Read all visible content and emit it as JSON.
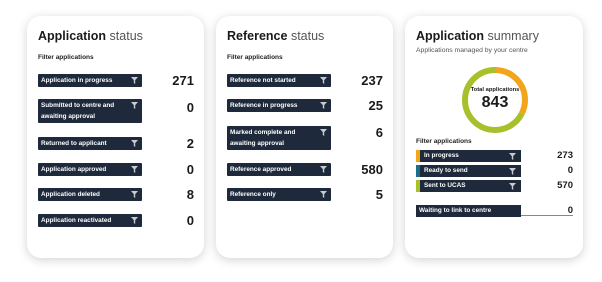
{
  "application_status": {
    "title_bold": "Application",
    "title_light": "status",
    "filter_label": "Filter applications",
    "rows": [
      {
        "label": "Application in progress",
        "count": "271"
      },
      {
        "label": "Submitted to centre and awaiting approval",
        "count": "0"
      },
      {
        "label": "Returned to applicant",
        "count": "2"
      },
      {
        "label": "Application approved",
        "count": "0"
      },
      {
        "label": "Application deleted",
        "count": "8"
      },
      {
        "label": "Application reactivated",
        "count": "0"
      }
    ]
  },
  "reference_status": {
    "title_bold": "Reference",
    "title_light": "status",
    "filter_label": "Filter applications",
    "rows": [
      {
        "label": "Reference not started",
        "count": "237"
      },
      {
        "label": "Reference in progress",
        "count": "25"
      },
      {
        "label": "Marked complete and awaiting approval",
        "count": "6"
      },
      {
        "label": "Reference approved",
        "count": "580"
      },
      {
        "label": "Reference only",
        "count": "5"
      }
    ]
  },
  "application_summary": {
    "title_bold": "Application",
    "title_light": "summary",
    "subtitle": "Applications managed by your centre",
    "donut_label": "Total applications",
    "donut_value": "843",
    "filter_label": "Filter applications",
    "rows": [
      {
        "label": "In progress",
        "count": "273",
        "color": "#f2a51a"
      },
      {
        "label": "Ready to send",
        "count": "0",
        "color": "#1c6e8c"
      },
      {
        "label": "Sent to UCAS",
        "count": "570",
        "color": "#a7c02b"
      }
    ],
    "waiting": {
      "label": "Waiting to link to centre",
      "count": "0"
    },
    "donut_segments": [
      {
        "value": 273,
        "color": "#f2a51a"
      },
      {
        "value": 570,
        "color": "#a7c02b"
      }
    ]
  },
  "colors": {
    "button_bg": "#1e2a3b"
  },
  "icons": {
    "filter": "funnel-icon"
  }
}
